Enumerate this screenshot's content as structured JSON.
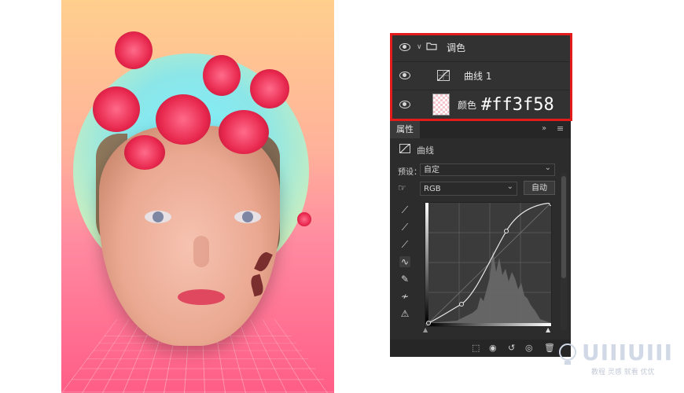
{
  "layers_panel": {
    "group_name": "调色",
    "curves_layer_name": "曲线 1",
    "fill_layer_name": "颜色",
    "fill_color": "#ff3f58"
  },
  "properties_panel": {
    "tab_label": "属性",
    "adjustment_type": "曲线",
    "preset_label": "预设：",
    "preset_value": "自定",
    "channel_value": "RGB",
    "auto_button": "自动",
    "collapse_icon": "double-chevron-right-icon",
    "menu_icon": "menu-icon"
  },
  "watermark": {
    "logo": "UIIIUIII",
    "tagline": "教程 灵感 就看 优优"
  },
  "colors": {
    "panel_bg": "#2c2c2c",
    "highlight_border": "#e41b1b",
    "accent_flower": "#e8284e"
  }
}
